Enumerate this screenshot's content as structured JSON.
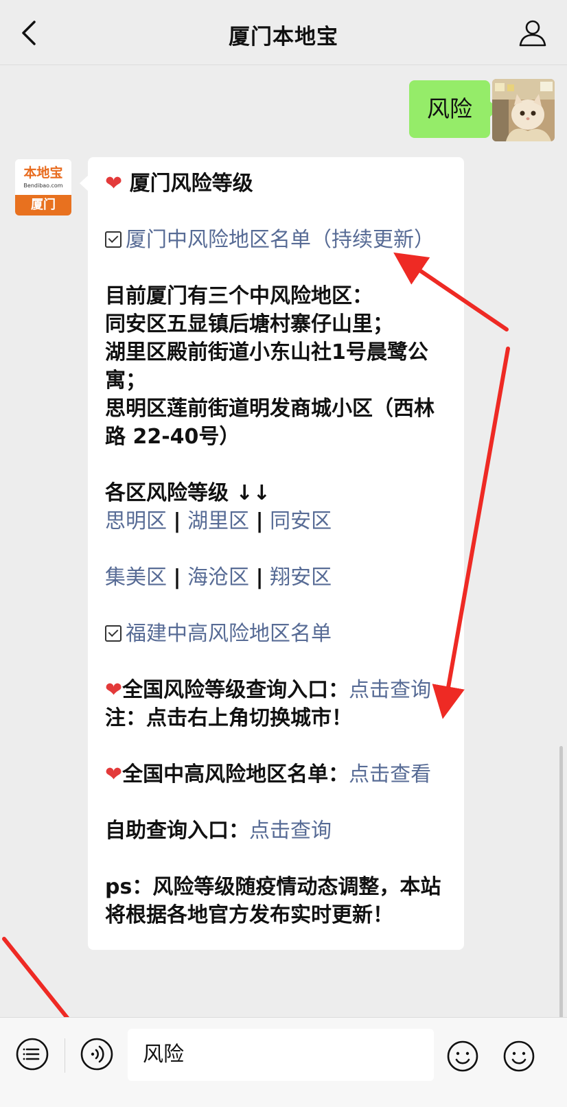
{
  "header": {
    "title": "厦门本地宝"
  },
  "chat": {
    "sent_message": "风险",
    "bot": {
      "avatar_brand": "本地宝",
      "avatar_brand_sub": "Bendibao.com",
      "avatar_city": "厦门"
    },
    "reply": {
      "heading": "厦门风险等级",
      "link_mid_risk_list": "厦门中风险地区名单（持续更新）",
      "intro": "目前厦门有三个中风险地区：",
      "area_1": "同安区五显镇后塘村寨仔山里；",
      "area_2": "湖里区殿前街道小东山社1号晨鹭公寓；",
      "area_3": "思明区莲前街道明发商城小区（西林路 22-40号）",
      "districts_title": "各区风险等级 ↓↓",
      "district_links": [
        "思明区",
        "湖里区",
        "同安区",
        "集美区",
        "海沧区",
        "翔安区"
      ],
      "separator": "|",
      "link_fujian": "福建中高风险地区名单",
      "national_query_label": "全国风险等级查询入口：",
      "national_query_link": "点击查询",
      "note": "注：点击右上角切换城市！",
      "national_list_label": "全国中高风险地区名单：",
      "national_list_link": "点击查看",
      "self_query_label": "自助查询入口：",
      "self_query_link": "点击查询",
      "ps": "ps：风险等级随疫情动态调整，本站将根据各地官方发布实时更新！"
    }
  },
  "input_bar": {
    "text": "风险"
  },
  "colors": {
    "link": "#576b95",
    "sent_bubble": "#95ec69",
    "annotation_arrow": "#ee2a24",
    "heart": "#e33a3a"
  },
  "icons": [
    "back-icon",
    "profile-icon",
    "heart-icon",
    "checkbox-icon",
    "menu-list-icon",
    "voice-icon",
    "emoji-icon"
  ]
}
